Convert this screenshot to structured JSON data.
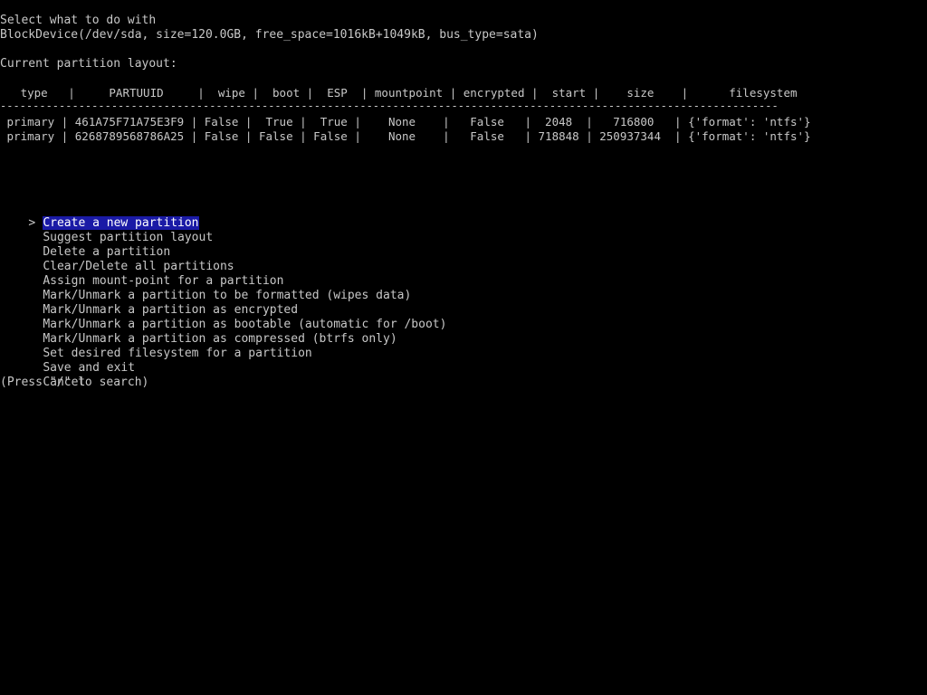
{
  "header": {
    "prompt_line1": "Select what to do with",
    "prompt_line2": "BlockDevice(/dev/sda, size=120.0GB, free_space=1016kB+1049kB, bus_type=sata)",
    "layout_title": "Current partition layout:"
  },
  "table": {
    "header_row": "   type   |     PARTUUID     |  wipe |  boot |  ESP  | mountpoint | encrypted |  start |    size    |      filesystem",
    "separator": "-----------------------------------------------------------------------------------------------------------------------",
    "rows": [
      " primary | 461A75F71A75E3F9 | False |  True |  True |    None    |   False   |  2048  |   716800   | {'format': 'ntfs'}",
      " primary | 6268789568786A25 | False | False | False |    None    |   False   | 718848 | 250937344  | {'format': 'ntfs'}"
    ]
  },
  "menu": {
    "cursor": ">",
    "items": [
      "Create a new partition",
      "Suggest partition layout",
      "Delete a partition",
      "Clear/Delete all partitions",
      "Assign mount-point for a partition",
      "Mark/Unmark a partition to be formatted (wipes data)",
      "Mark/Unmark a partition as encrypted",
      "Mark/Unmark a partition as bootable (automatic for /boot)",
      "Mark/Unmark a partition as compressed (btrfs only)",
      "Set desired filesystem for a partition",
      "Save and exit",
      "Cancel"
    ],
    "selected_index": 0
  },
  "footer": {
    "search_hint": "(Press \"/\" to search)"
  },
  "colors": {
    "background": "#000000",
    "text": "#c8c8c8",
    "selection_bg": "#1a1aa6",
    "selection_fg": "#ffffff"
  }
}
